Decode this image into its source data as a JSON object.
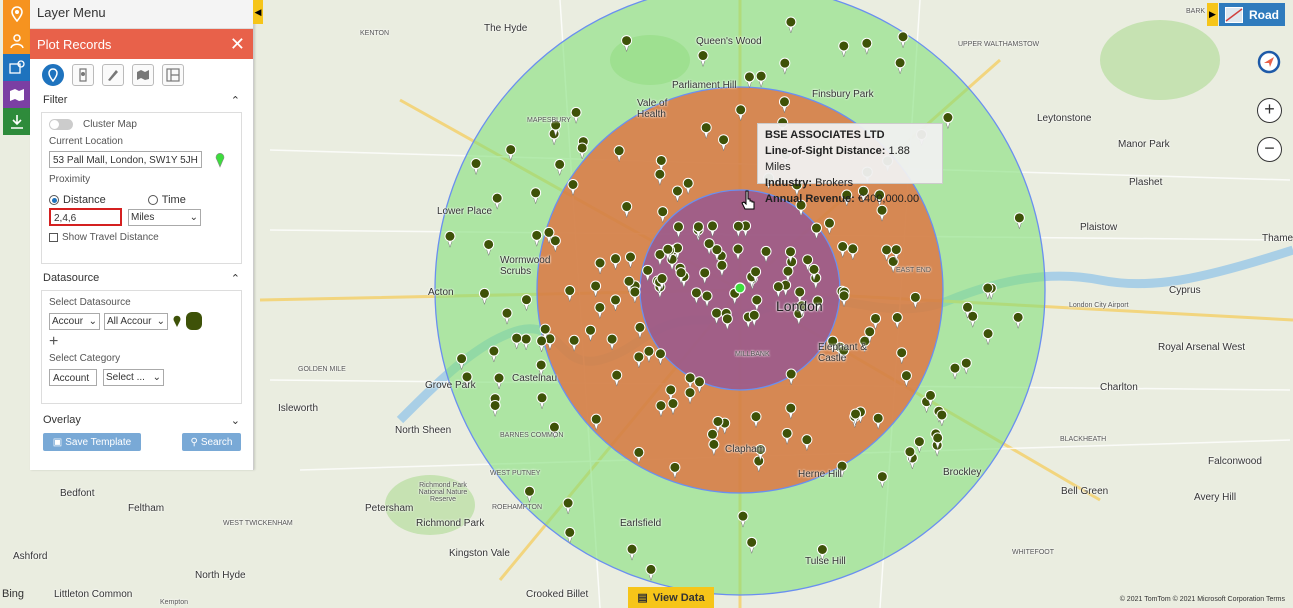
{
  "layer_menu": {
    "title": "Layer Menu",
    "plot_records_title": "Plot Records",
    "close_glyph": "✕",
    "filter": {
      "heading": "Filter",
      "cluster_map_label": "Cluster Map",
      "current_location_label": "Current Location",
      "current_location_value": "53 Pall Mall, London, SW1Y 5JH",
      "proximity_label": "Proximity",
      "distance_label": "Distance",
      "time_label": "Time",
      "distance_value": "2,4,6",
      "unit_value": "Miles",
      "show_travel_distance_label": "Show Travel Distance"
    },
    "datasource": {
      "heading": "Datasource",
      "select_datasource_label": "Select Datasource",
      "entity_value": "Accour",
      "view_value": "All Accour",
      "add_glyph": "+",
      "select_category_label": "Select Category",
      "category_entity_value": "Account",
      "category_value": "Select ..."
    },
    "overlay_heading": "Overlay",
    "save_template_label": "Save Template",
    "search_label": "Search"
  },
  "road_label": "Road",
  "zoom_in": "+",
  "zoom_out": "−",
  "view_data_label": "View Data",
  "bing_label": "Bing",
  "copyright": "© 2021 TomTom © 2021 Microsoft Corporation  Terms",
  "tooltip": {
    "name": "BSE ASSOCIATES LTD",
    "distance_label": "Line-of-Sight Distance:",
    "distance_value": "1.88 Miles",
    "industry_label": "Industry:",
    "industry_value": "Brokers",
    "revenue_label": "Annual Revenue:",
    "revenue_value": "€400,000.00"
  },
  "map_labels": {
    "london": "London",
    "the_hyde": "The Hyde",
    "queens_wood": "Queen's Wood",
    "parliament_hill": "Parliament Hill",
    "finsbury_park": "Finsbury Park",
    "leytonstone": "Leytonstone",
    "manor_park": "Manor Park",
    "plashet": "Plashet",
    "plaistow": "Plaistow",
    "thames": "Thame",
    "cyprus": "Cyprus",
    "london_city_airport": "London City Airport",
    "royal_arsenal_west": "Royal Arsenal West",
    "charlton": "Charlton",
    "blackheath": "BLACKHEATH",
    "falconwood": "Falconwood",
    "brockley": "Brockley",
    "bell_green": "Bell Green",
    "avery_hill": "Avery Hill",
    "whitefoot": "WHITEFOOT",
    "tulse_hill": "Tulse Hill",
    "crooked_billet": "Crooked Billet",
    "kingston_vale": "Kingston Vale",
    "earlsfield": "Earlsfield",
    "clapham": "Clapham",
    "herne_hill": "Herne Hill",
    "elephant_castle": "Elephant & Castle",
    "millbank": "MILLBANK",
    "petersham": "Petersham",
    "richmond_park": "Richmond Park",
    "richmond_park_reserve": "Richmond Park National Nature Reserve",
    "feltham": "Feltham",
    "bedfont": "Bedfont",
    "ashford": "Ashford",
    "north_hyde": "North Hyde",
    "littleton_common": "Littleton Common",
    "kempton": "Kempton",
    "west_twickenham": "WEST TWICKENHAM",
    "west_putney": "WEST PUTNEY",
    "roehampton": "ROEHAMPTON",
    "isleworth": "Isleworth",
    "north_sheen": "North Sheen",
    "grove_park": "Grove Park",
    "castelnau": "Castelnau",
    "barnes_common": "BARNES COMMON",
    "acton": "Acton",
    "wormwood_scrubs": "Wormwood Scrubs",
    "lower_place": "Lower Place",
    "golden_mile": "GOLDEN MILE",
    "vale_of_health": "Vale of Health",
    "mapesbury": "MAPESBURY",
    "kenton": "KENTON",
    "upper_walthamstow": "UPPER WALTHAMSTOW",
    "east_end": "EAST END",
    "barking": "BARK"
  },
  "icons": {
    "nav": [
      "map-pin-icon",
      "people-icon",
      "locations-icon",
      "territory-icon",
      "download-icon"
    ],
    "toolbar": [
      "plot-pin-icon",
      "route-icon",
      "draw-icon",
      "region-icon",
      "layout-icon"
    ]
  },
  "colors": {
    "inner_ring": "#8a4f9e",
    "middle_ring": "#e0713f",
    "outer_ring": "#83e07a",
    "pin": "#3e5208",
    "center_pin": "#3ddc3d",
    "panel_header": "#e8614a",
    "accent_orange": "#f6931f",
    "accent_yellow": "#f6c519",
    "road_button": "#2f7bbd"
  }
}
